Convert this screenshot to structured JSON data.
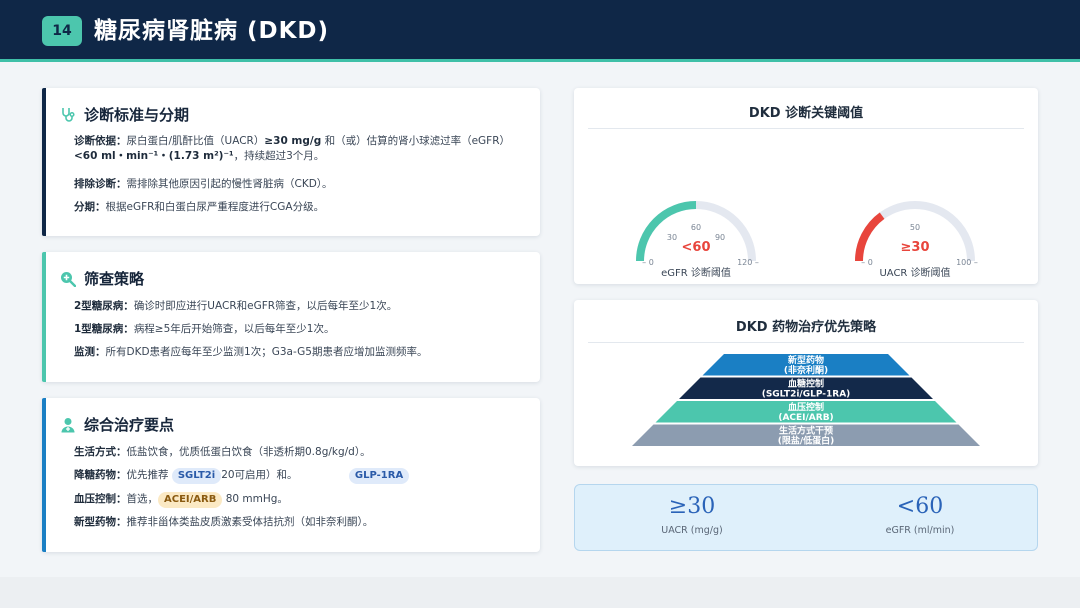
{
  "header": {
    "page_number": "14",
    "title": "糖尿病肾脏病 (DKD)"
  },
  "diagnosis": {
    "title": "诊断标准与分期",
    "basis_label": "诊断依据：",
    "basis_text_a": "尿白蛋白/肌酐比值（UACR）",
    "basis_strong_a": "≥30 mg/g",
    "basis_text_b": " 和（或）估算的肾小球滤过率（eGFR）",
    "basis_strong_b": "<60 ml・min⁻¹・(1.73 m²)⁻¹",
    "basis_text_c": "，持续超过3个月。",
    "exclude_label": "排除诊断：",
    "exclude_text": "需排除其他原因引起的慢性肾脏病（CKD）。",
    "staging_label": "分期：",
    "staging_text": "根据eGFR和白蛋白尿严重程度进行CGA分级。"
  },
  "screening": {
    "title": "筛查策略",
    "t2_label": "2型糖尿病：",
    "t2_text": "确诊时即应进行UACR和eGFR筛查，以后每年至少1次。",
    "t1_label": "1型糖尿病：",
    "t1_text": "病程≥5年后开始筛查，以后每年至少1次。",
    "monitor_label": "监测：",
    "monitor_text": "所有DKD患者应每年至少监测1次；G3a-G5期患者应增加监测频率。"
  },
  "treatment": {
    "title": "综合治疗要点",
    "lifestyle_label": "生活方式：",
    "lifestyle_text": "低盐饮食，优质低蛋白饮食（非透析期0.8g/kg/d）。",
    "glucose_label": "降糖药物：",
    "glucose_text_a": "优先推荐",
    "glucose_tag_a": "SGLT2i",
    "glucose_text_b": "20可启用）和。",
    "glucose_tag_b": "GLP-1RA",
    "bp_label": "血压控制：",
    "bp_text_a": "首选，",
    "bp_tag": "ACEI/ARB",
    "bp_text_b": "80 mmHg。",
    "new_label": "新型药物：",
    "new_text": "推荐非甾体类盐皮质激素受体拮抗剂（如非奈利酮）。"
  },
  "thresholds": {
    "title": "DKD 诊断关键阈值",
    "egfr": {
      "value_text": "<60",
      "label": "eGFR 诊断阈值",
      "min": 0,
      "max": 120,
      "mid": 60,
      "value": 60,
      "ticks": [
        "0",
        "30",
        "60",
        "90",
        "120"
      ]
    },
    "uacr": {
      "value_text": "≥30",
      "label": "UACR 诊断阈值",
      "min": 0,
      "max": 100,
      "mid": 50,
      "value": 30,
      "ticks": [
        "0",
        "50",
        "100"
      ]
    }
  },
  "pyramid": {
    "title": "DKD 药物治疗优先策略",
    "levels": [
      {
        "line1": "新型药物",
        "line2": "(非奈利酮)",
        "color": "#1a7fc4"
      },
      {
        "line1": "血糖控制",
        "line2": "(SGLT2i/GLP-1RA)",
        "color": "#13294a"
      },
      {
        "line1": "血压控制",
        "line2": "(ACEI/ARB)",
        "color": "#4cc6ad"
      },
      {
        "line1": "生活方式干预",
        "line2": "(限盐/低蛋白)",
        "color": "#8c9cb0"
      }
    ]
  },
  "stats": [
    {
      "value": "≥30",
      "label": "UACR (mg/g)"
    },
    {
      "value": "<60",
      "label": "eGFR (ml/min)"
    }
  ],
  "colors": {
    "navy": "#0f2747",
    "teal": "#4cc6ad",
    "red": "#e8453c",
    "blue": "#1565c0"
  }
}
